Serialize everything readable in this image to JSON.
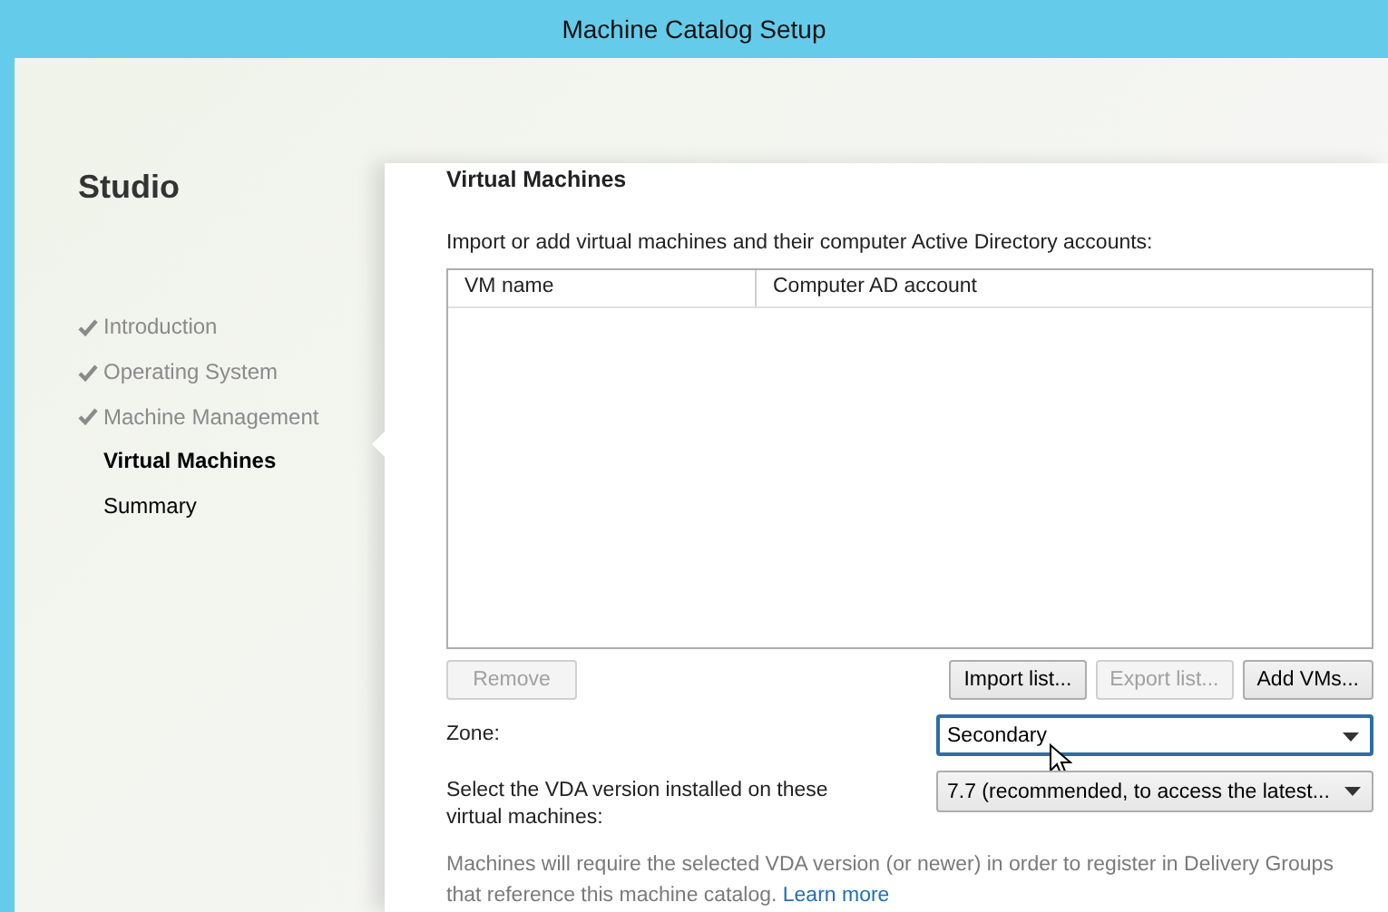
{
  "window": {
    "title": "Machine Catalog Setup"
  },
  "sidebar": {
    "title": "Studio",
    "steps": [
      {
        "label": "Introduction",
        "completed": true,
        "selected": false
      },
      {
        "label": "Operating System",
        "completed": true,
        "selected": false
      },
      {
        "label": "Machine Management",
        "completed": true,
        "selected": false
      },
      {
        "label": "Virtual Machines",
        "completed": false,
        "selected": true
      },
      {
        "label": "Summary",
        "completed": false,
        "selected": false
      }
    ]
  },
  "page": {
    "heading": "Virtual Machines",
    "intro": "Import or add virtual machines and their computer Active Directory accounts:",
    "table": {
      "columns": [
        "VM name",
        "Computer AD account"
      ]
    },
    "remove_button": {
      "label": "Remove",
      "disabled": true
    },
    "buttons": [
      {
        "label": "Import list...",
        "disabled": false
      },
      {
        "label": "Export list...",
        "disabled": true
      },
      {
        "label": "Add VMs...",
        "disabled": false
      }
    ],
    "fields": [
      {
        "label": "Zone:",
        "value": "Secondary",
        "focused": true
      },
      {
        "label": "Select the VDA version installed on these virtual machines:",
        "value": "7.7 (recommended, to access the latest...",
        "focused": false
      }
    ],
    "note": {
      "text": "Machines will require the selected VDA version (or newer) in order to register in Delivery Groups that reference this machine catalog.",
      "link": "Learn more"
    }
  }
}
